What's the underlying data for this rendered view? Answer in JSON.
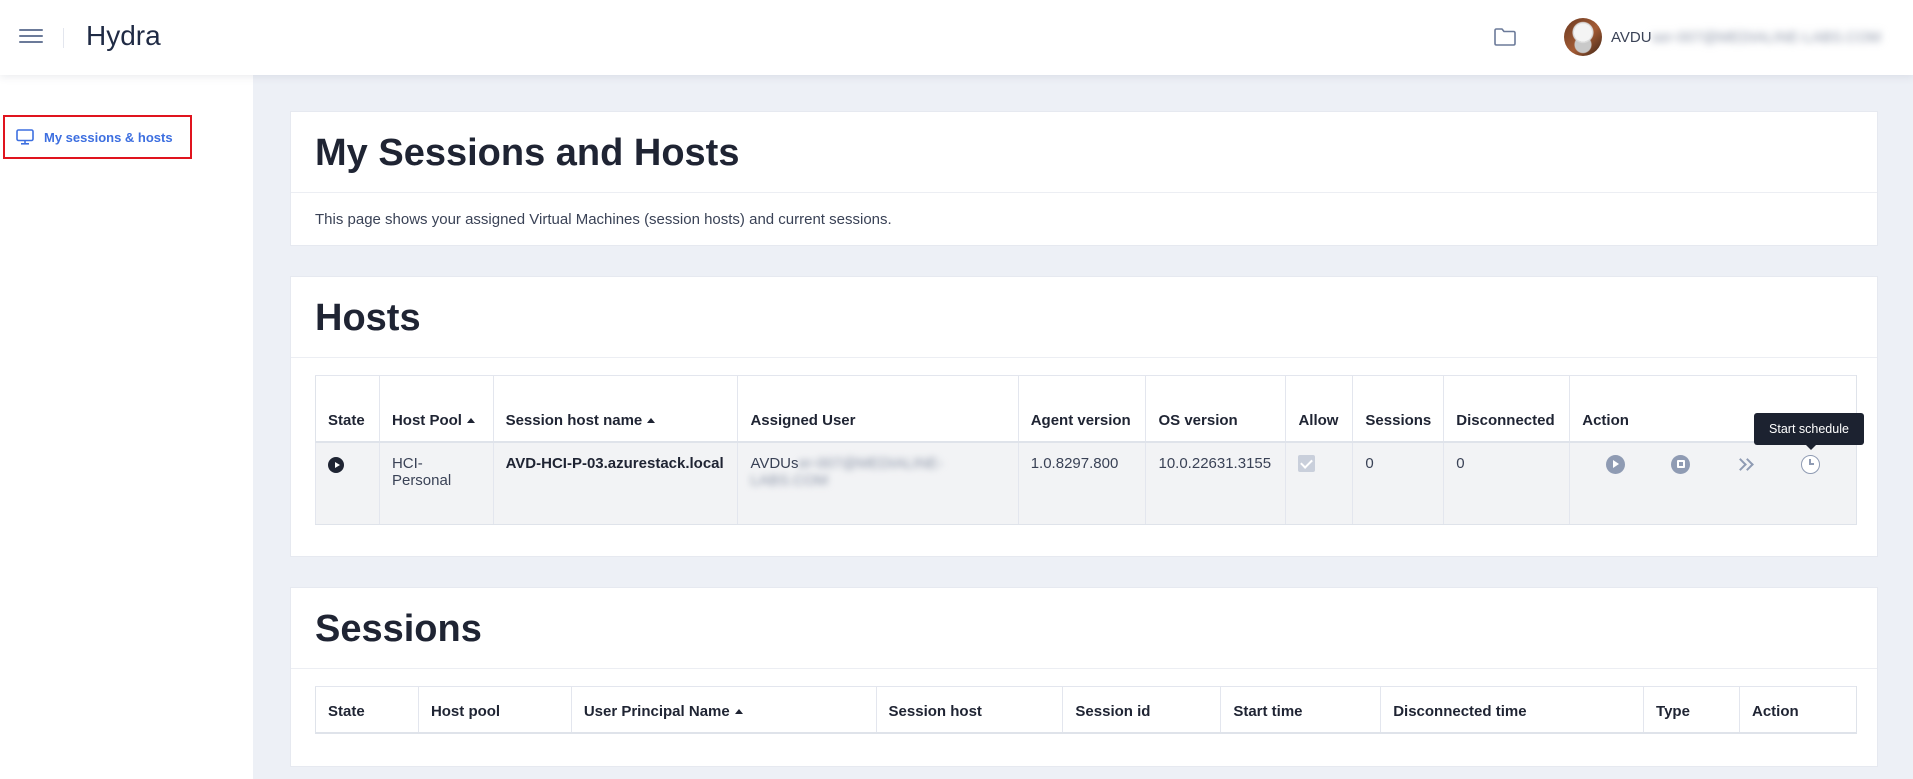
{
  "header": {
    "app_title": "Hydra",
    "user_prefix": "AVDU",
    "user_blurred": "ser-007@MEDIALINE-LABS.COM"
  },
  "sidebar": {
    "items": [
      {
        "label": "My sessions & hosts",
        "icon": "monitor-icon",
        "active": true
      }
    ]
  },
  "intro": {
    "title": "My Sessions and Hosts",
    "description": "This page shows your assigned Virtual Machines (session hosts) and current sessions."
  },
  "hosts": {
    "title": "Hosts",
    "columns": {
      "state": "State",
      "host_pool": "Host Pool",
      "session_host_name": "Session host name",
      "assigned_user": "Assigned User",
      "agent_version": "Agent version",
      "os_version": "OS version",
      "allow": "Allow",
      "sessions": "Sessions",
      "disconnected": "Disconnected",
      "action": "Action"
    },
    "rows": [
      {
        "state": "running",
        "host_pool": "HCI-Personal",
        "session_host_name": "AVD-HCI-P-03.azurestack.local",
        "assigned_user_prefix": "AVDUs",
        "assigned_user_blurred": "er-007@MEDIALINE-LABS.COM",
        "agent_version": "1.0.8297.800",
        "os_version": "10.0.22631.3155",
        "allow": true,
        "sessions": "0",
        "disconnected": "0"
      }
    ],
    "tooltip": "Start schedule"
  },
  "sessions": {
    "title": "Sessions",
    "columns": {
      "state": "State",
      "host_pool": "Host pool",
      "upn": "User Principal Name",
      "session_host": "Session host",
      "session_id": "Session id",
      "start_time": "Start time",
      "disconnected_time": "Disconnected time",
      "type": "Type",
      "action": "Action"
    }
  },
  "colors": {
    "accent": "#3d6fe0",
    "highlight_border": "#e0141e",
    "icon_gray": "#8f9bb3",
    "background": "#edf0f6"
  }
}
